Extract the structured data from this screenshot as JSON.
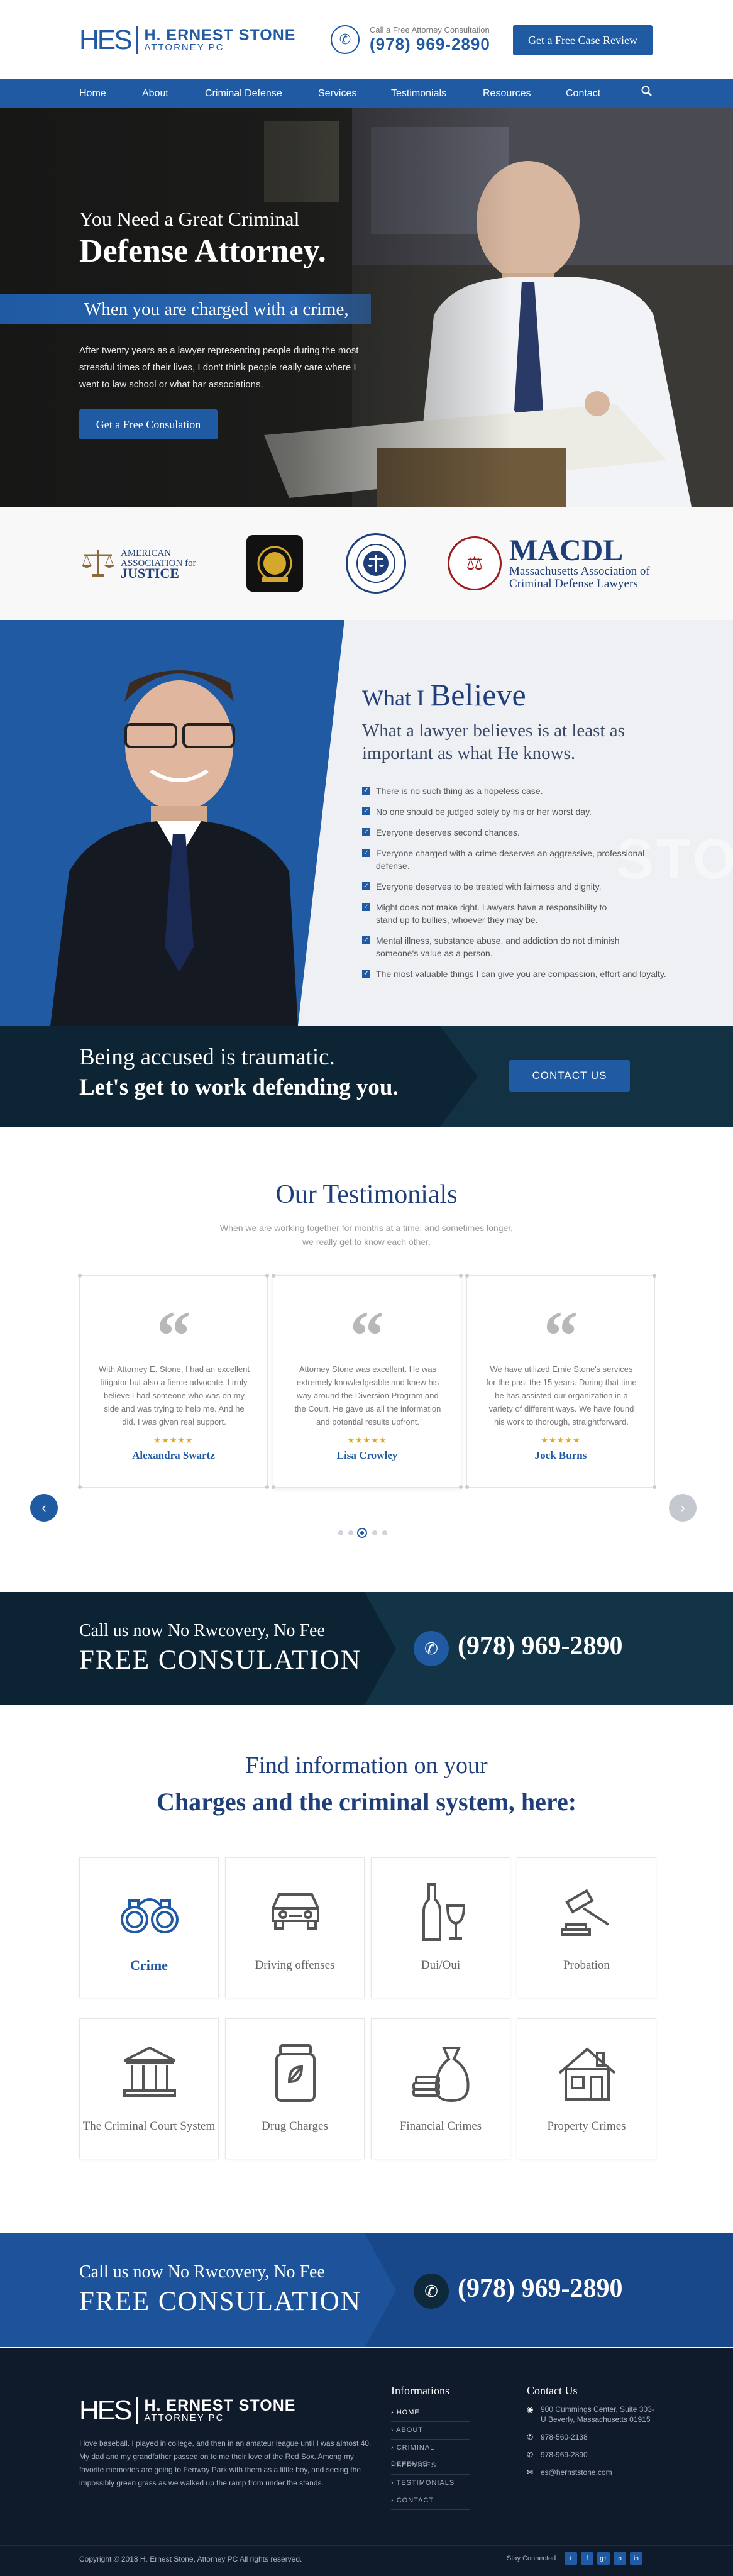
{
  "header": {
    "logo_mark": "HES",
    "logo_name": "H. ERNEST STONE",
    "logo_sub": "ATTORNEY PC",
    "call_label": "Call a Free Attorney Consultation",
    "call_number": "(978) 969-2890",
    "cta": "Get a Free Case Review"
  },
  "nav": {
    "items": [
      "Home",
      "About",
      "Criminal Defense",
      "Services",
      "Testimonials",
      "Resources",
      "Contact"
    ],
    "search_icon": "search-icon"
  },
  "hero": {
    "pre": "You Need a Great Criminal",
    "title": "Defense Attorney.",
    "band": "When you are charged with a crime,",
    "body": "After twenty years as a lawyer representing people during the most stressful times of their lives, I don't think people really care where I went to law school or what bar associations.",
    "button": "Get a Free Consulation"
  },
  "logos": {
    "aaj_line1": "AMERICAN",
    "aaj_line2": "ASSOCIATION for",
    "aaj_line3": "JUSTICE",
    "macdl_name": "MACDL",
    "macdl_sub1": "Massachusetts Association of",
    "macdl_sub2": "Criminal Defense Lawyers"
  },
  "believe": {
    "title_a": "What I",
    "title_b": "Believe",
    "subtitle": "What a lawyer believes is at least as important as what He knows.",
    "items": [
      "There is no such thing as a hopeless case.",
      "No one should be judged solely by his or her worst day.",
      "Everyone deserves second chances.",
      "Everyone charged with a crime deserves an aggressive, professional defense.",
      "Everyone deserves to be treated with fairness and dignity.",
      "Might does not make right. Lawyers have a responsibility to stand up to bullies, whoever they may be.",
      "Mental illness, substance abuse, and addiction do not diminish someone's value as a person.",
      "The most valuable things I can give you are compassion, effort and loyalty."
    ]
  },
  "trauma": {
    "line1": "Being accused is traumatic.",
    "line2": "Let's get to work defending you.",
    "button": "CONTACT US"
  },
  "testimonials": {
    "title_a": "Our",
    "title_b": "Testimonials",
    "subtitle": "When we are working together for months at a time, and sometimes longer, we really get to know each other.",
    "cards": [
      {
        "text": "With Attorney E. Stone, I had an excellent litigator but also a fierce advocate. I truly believe I had someone who was on my side and was trying to help me. And he did. I was given real support.",
        "stars": "★★★★★",
        "name": "Alexandra Swartz"
      },
      {
        "text": "Attorney Stone was excellent. He was extremely knowledgeable and knew his way around the Diversion Program and the Court. He gave us all the information and potential results upfront.",
        "stars": "★★★★★",
        "name": "Lisa Crowley"
      },
      {
        "text": "We have utilized Ernie Stone's services for the past the 15 years. During that time he has assisted our organization in a variety of different ways. We have found his work to thorough, straightforward.",
        "stars": "★★★★★",
        "name": "Jock Burns"
      }
    ],
    "active_dot": 3
  },
  "consult": {
    "line1": "Call us now No Rwcovery, No Fee",
    "line2": "FREE CONSULATION",
    "number": "(978) 969-2890"
  },
  "charges": {
    "title1": "Find information on your",
    "title2": "Charges and the criminal system, here:",
    "items": [
      {
        "label": "Crime",
        "icon": "handcuffs-icon"
      },
      {
        "label": "Driving offenses",
        "icon": "car-icon"
      },
      {
        "label": "Dui/Oui",
        "icon": "bottle-glass-icon"
      },
      {
        "label": "Probation",
        "icon": "gavel-icon"
      },
      {
        "label": "The Criminal Court System",
        "icon": "courthouse-icon"
      },
      {
        "label": "Drug Charges",
        "icon": "pill-jar-icon"
      },
      {
        "label": "Financial Crimes",
        "icon": "money-bag-icon"
      },
      {
        "label": "Property Crimes",
        "icon": "house-icon"
      }
    ]
  },
  "footer": {
    "about": "I love baseball. I played in college, and then in an amateur league until I was almost 40. My dad and my grandfather passed on to me their love of the Red Sox. Among my favorite memories are going to Fenway Park with them as a little boy, and seeing the impossibly green grass as we walked up the ramp from under the stands.",
    "informations_title": "Informations",
    "links": [
      "HOME",
      "ABOUT",
      "CRIMINAL DEFENSE",
      "SERVICES",
      "TESTIMONIALS",
      "CONTACT"
    ],
    "contact_title": "Contact Us",
    "address": "900 Cummings Center, Suite 303-U Beverly, Massachusetts 01915",
    "fax": "978-560-2138",
    "phone": "978-969-2890",
    "email": "es@hernststone.com",
    "copyright": "Copyright © 2018 H. Ernest Stone, Attorney PC All rights reserved.",
    "stay": "Stay Connected",
    "social": [
      "t",
      "f",
      "g+",
      "p",
      "in"
    ]
  },
  "colors": {
    "brand": "#1f5aa3",
    "navy": "#0e2a3a",
    "footer": "#0f1a2b",
    "star": "#e2a81a"
  }
}
